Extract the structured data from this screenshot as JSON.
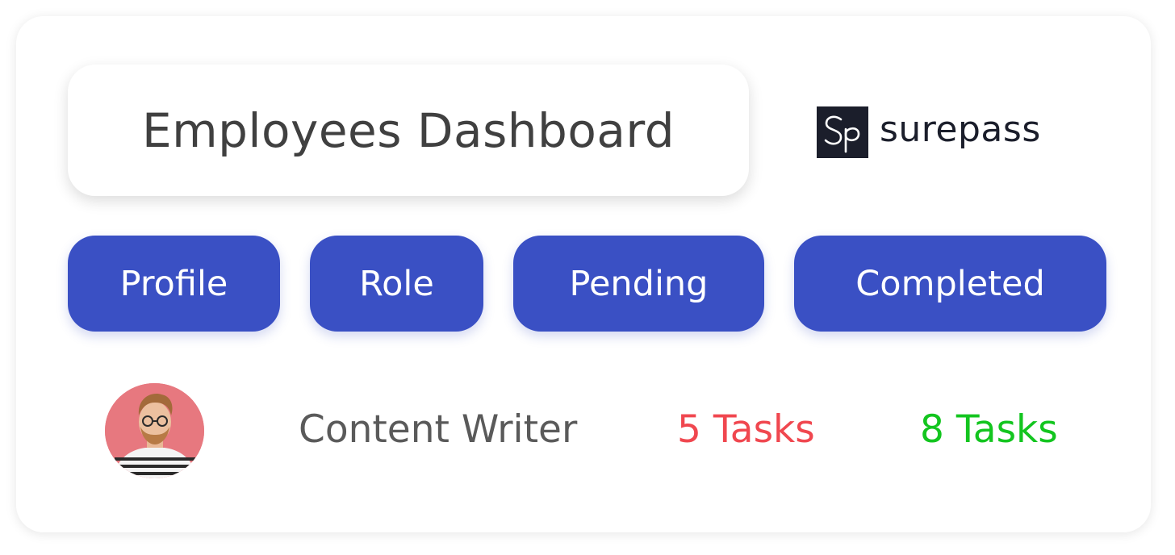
{
  "header": {
    "title": "Employees Dashboard",
    "brand_mark": "Sp",
    "brand_name": "surepass"
  },
  "tabs": [
    {
      "label": "Profile"
    },
    {
      "label": "Role"
    },
    {
      "label": "Pending"
    },
    {
      "label": "Completed"
    }
  ],
  "employee": {
    "avatar_icon": "user-avatar-photo",
    "role": "Content Writer",
    "pending": "5 Tasks",
    "completed": "8 Tasks"
  },
  "colors": {
    "accent": "#3a50c4",
    "pending": "#f0474f",
    "completed": "#13c51f",
    "title": "#404040",
    "brand_dark": "#1b1e2b"
  }
}
